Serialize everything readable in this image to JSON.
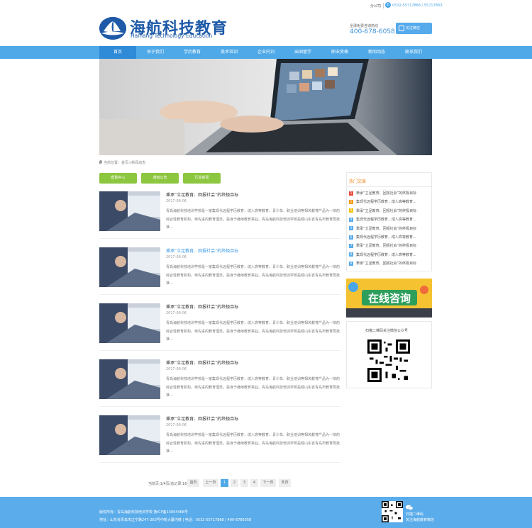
{
  "topbar": {
    "branch": "分公司",
    "phones": "0532-55717868 / 55717883"
  },
  "logo": {
    "cn": "海航科技教育",
    "en": "Haihang Technology Education"
  },
  "hotline": {
    "label": "全球免费咨询热线",
    "number": "400-678-6058"
  },
  "follow_btn": "关注微信",
  "nav": [
    "首页",
    "关于我们",
    "学历教育",
    "美术培训",
    "企业内训",
    "出国留学",
    "职业资格",
    "新闻动态",
    "联系我们"
  ],
  "breadcrumb": "当前位置：首页>新闻动态",
  "tabs": [
    "帮助中心",
    "通知公告",
    "行业新闻"
  ],
  "articles": [
    {
      "title": "秉承“立足教育、回报社会”的终极目标",
      "date": "2017-06-06",
      "desc": "青岛海航科技培训学校是一家集现代远程学历教育，成人高等教育，青少年、职业培训等相关教育产品为一体的综合性教育机构，待先进的教育理念，投身于继续教育事业。青岛海航科技培训学校是经山东省青岛市教育局批准..."
    },
    {
      "title": "秉承“立足教育、回报社会”的终极目标",
      "date": "2017-06-06",
      "desc": "青岛海航科技培训学校是一家集现代远程学历教育，成人高等教育，青少年、职业培训等相关教育产品为一体的综合性教育机构，待先进的教育理念，投身于继续教育事业。青岛海航科技培训学校是经山东省青岛市教育局批准..."
    },
    {
      "title": "秉承“立足教育、回报社会”的终极目标",
      "date": "2017-06-06",
      "desc": "青岛海航科技培训学校是一家集现代远程学历教育，成人高等教育，青少年、职业培训等相关教育产品为一体的综合性教育机构，待先进的教育理念，投身于继续教育事业。青岛海航科技培训学校是经山东省青岛市教育局批准..."
    },
    {
      "title": "秉承“立足教育、回报社会”的终极目标",
      "date": "2017-06-06",
      "desc": "青岛海航科技培训学校是一家集现代远程学历教育，成人高等教育，青少年、职业培训等相关教育产品为一体的综合性教育机构，待先进的教育理念，投身于继续教育事业。青岛海航科技培训学校是经山东省青岛市教育局批准..."
    },
    {
      "title": "秉承“立足教育、回报社会”的终极目标",
      "date": "2017-06-06",
      "desc": "青岛海航科技培训学校是一家集现代远程学历教育，成人高等教育，青少年、职业培训等相关教育产品为一体的综合性教育机构，待先进的教育理念，投身于继续教育事业。青岛海航科技培训学校是经山东省青岛市教育局批准..."
    }
  ],
  "hot": {
    "title": "热门文章",
    "items": [
      {
        "n": "1",
        "text": "秉承“立足教育、回报社会”的终极目标",
        "color": "#e74c3c"
      },
      {
        "n": "2",
        "text": "集现代远程学历教育，成人高等教育...",
        "color": "#f39c12"
      },
      {
        "n": "3",
        "text": "秉承“立足教育、回报社会”的终极目标",
        "color": "#f1c40f"
      },
      {
        "n": "4",
        "text": "集现代远程学历教育，成人高等教育...",
        "color": "#5aacea"
      },
      {
        "n": "5",
        "text": "秉承“立足教育、回报社会”的终极目标",
        "color": "#5aacea"
      },
      {
        "n": "6",
        "text": "集现代远程学历教育，成人高等教育...",
        "color": "#5aacea"
      },
      {
        "n": "7",
        "text": "秉承“立足教育、回报社会”的终极目标",
        "color": "#5aacea"
      },
      {
        "n": "8",
        "text": "集现代远程学历教育，成人高等教育...",
        "color": "#5aacea"
      },
      {
        "n": "9",
        "text": "秉承“立足教育、回报社会”的终极目标",
        "color": "#5aacea"
      }
    ]
  },
  "consult_text": "在线咨询",
  "qr_title": "扫描二维码关注微信公众号",
  "pager": {
    "info": "当前页:1/4页/总记录:16条",
    "first": "首页",
    "prev": "上一页",
    "pages": [
      "1",
      "2",
      "3",
      "4"
    ],
    "next": "下一页",
    "last": "末页"
  },
  "footer": {
    "line1": "版权所有：青岛海航科技培训学校   鲁ICP备13004468号",
    "line2": "地址：山东省青岛市辽宁路247-263号中新大厦内楼  |  电话：0532-55717868 / 400-6786058",
    "qr_t1": "扫描二维码",
    "qr_t2": "关注海航教育微信"
  }
}
